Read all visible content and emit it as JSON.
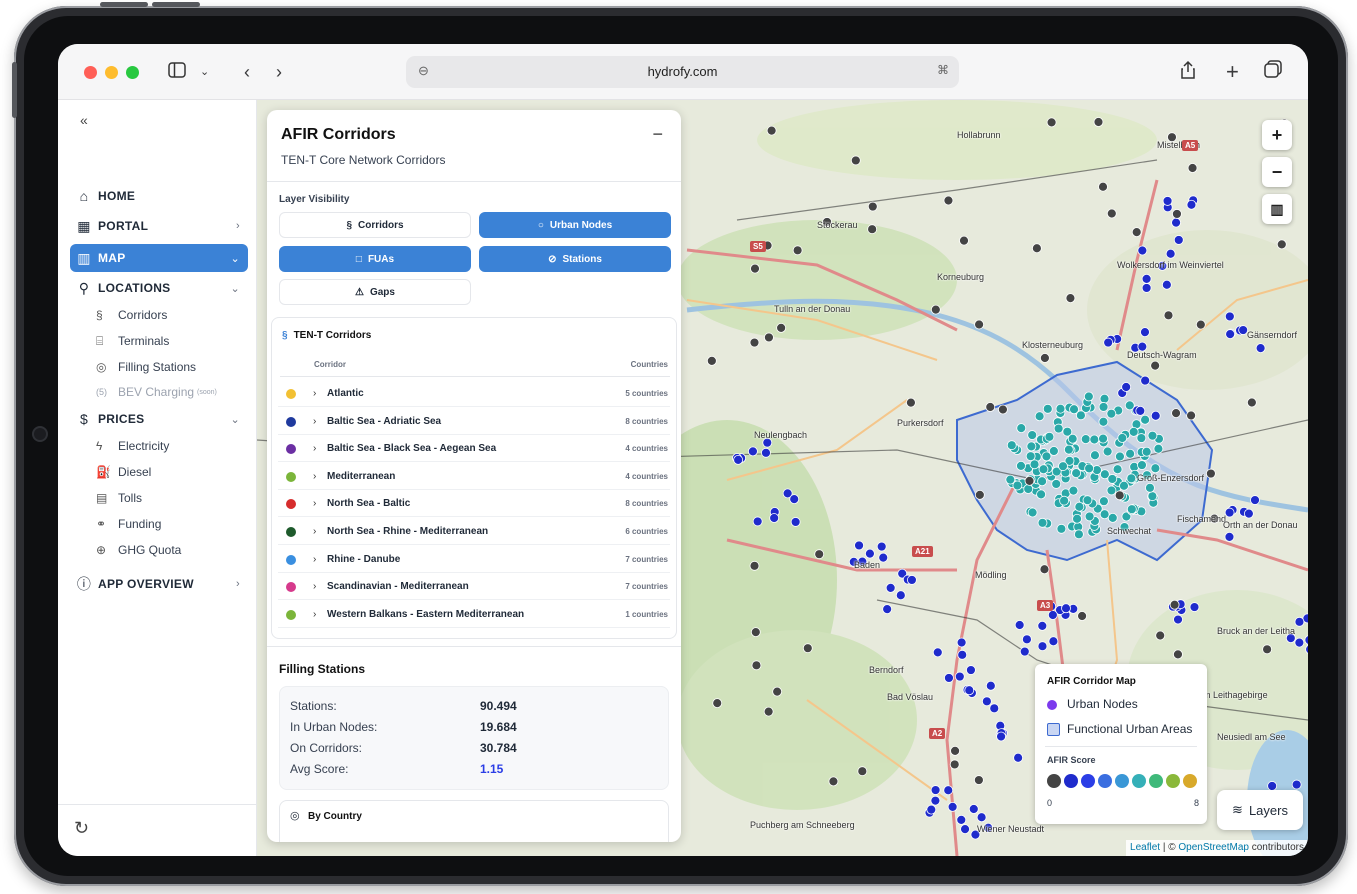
{
  "browser": {
    "url": "hydrofy.com"
  },
  "sidebar": {
    "collapse_icon": "«",
    "items": [
      {
        "label": "HOME"
      },
      {
        "label": "PORTAL"
      },
      {
        "label": "MAP"
      },
      {
        "label": "LOCATIONS"
      },
      {
        "label": "PRICES"
      },
      {
        "label": "APP OVERVIEW"
      }
    ],
    "locations": [
      {
        "label": "Corridors"
      },
      {
        "label": "Terminals"
      },
      {
        "label": "Filling Stations"
      },
      {
        "label": "BEV Charging",
        "badge": "(soon)"
      }
    ],
    "prices": [
      {
        "label": "Electricity"
      },
      {
        "label": "Diesel"
      },
      {
        "label": "Tolls"
      },
      {
        "label": "Funding"
      },
      {
        "label": "GHG Quota"
      }
    ]
  },
  "panel": {
    "title": "AFIR Corridors",
    "subtitle": "TEN-T Core Network Corridors",
    "collapse_label": "−",
    "layer_heading": "Layer Visibility",
    "layers": [
      {
        "label": "Corridors",
        "active": false
      },
      {
        "label": "Urban Nodes",
        "active": true
      },
      {
        "label": "FUAs",
        "active": true
      },
      {
        "label": "Stations",
        "active": true
      },
      {
        "label": "Gaps",
        "active": false
      }
    ],
    "corridors_heading": "TEN-T Corridors",
    "col_corridor": "Corridor",
    "col_countries": "Countries",
    "corridors": [
      {
        "name": "Atlantic",
        "countries": "5 countries",
        "color": "#f2c033"
      },
      {
        "name": "Baltic Sea - Adriatic Sea",
        "countries": "8 countries",
        "color": "#1f3a9e"
      },
      {
        "name": "Baltic Sea - Black Sea - Aegean Sea",
        "countries": "4 countries",
        "color": "#6b2fa3"
      },
      {
        "name": "Mediterranean",
        "countries": "4 countries",
        "color": "#7bb53a"
      },
      {
        "name": "North Sea - Baltic",
        "countries": "8 countries",
        "color": "#d62d2d"
      },
      {
        "name": "North Sea - Rhine - Mediterranean",
        "countries": "6 countries",
        "color": "#1e5a2c"
      },
      {
        "name": "Rhine - Danube",
        "countries": "7 countries",
        "color": "#3a8fe0"
      },
      {
        "name": "Scandinavian - Mediterranean",
        "countries": "7 countries",
        "color": "#d63a8c"
      },
      {
        "name": "Western Balkans - Eastern Mediterranean",
        "countries": "1 countries",
        "color": "#7bb53a"
      }
    ],
    "filling_heading": "Filling Stations",
    "stats": [
      {
        "label": "Stations:",
        "value": "90.494"
      },
      {
        "label": "In Urban Nodes:",
        "value": "19.684"
      },
      {
        "label": "On Corridors:",
        "value": "30.784"
      },
      {
        "label": "Avg Score:",
        "value": "1.15"
      }
    ],
    "by_country": "By Country"
  },
  "map": {
    "zoom_in": "+",
    "zoom_out": "−",
    "place_labels": [
      "Korneuburg",
      "Wolkersdorf im Weinviertel",
      "Tulln an der Donau",
      "Klosterneuburg",
      "Deutsch-Wagram",
      "Purkersdorf",
      "Neulengbach",
      "Groß-Enzersdorf",
      "Schwechat",
      "Fischamend",
      "Mödling",
      "Baden",
      "Bad Vöslau",
      "Mannersdorf am Leithagebirge",
      "Bruck an der Leitha",
      "Neusiedl am See",
      "Wiener Neustadt",
      "Puchberg am Schneeberg",
      "Berndorf",
      "Orth an der Donau",
      "Stockerau",
      "Hollabrunn",
      "Mistelbach",
      "Gänserndorf"
    ],
    "road_labels": [
      "S5",
      "A21",
      "A3",
      "A2",
      "A5"
    ],
    "legend": {
      "title": "AFIR Corridor Map",
      "urban_nodes": "Urban Nodes",
      "fua": "Functional Urban Areas",
      "score_title": "AFIR Score",
      "score_min": "0",
      "score_max": "8",
      "score_colors": [
        "#444444",
        "#1f2bcc",
        "#2b3ee6",
        "#3a6ee0",
        "#3a97d6",
        "#35b0b8",
        "#3fb97a",
        "#8ab83a",
        "#d8a92b"
      ]
    },
    "layers_label": "Layers",
    "attribution_leaflet": "Leaflet",
    "attribution_osm": "OpenStreetMap",
    "attribution_rest": "contributors",
    "colors": {
      "accent": "#3b82d6",
      "urban_node": "#7c3aed",
      "station_low": "#1f2bcc",
      "station_teal": "#2aa8a8",
      "station_dark": "#444444"
    }
  }
}
